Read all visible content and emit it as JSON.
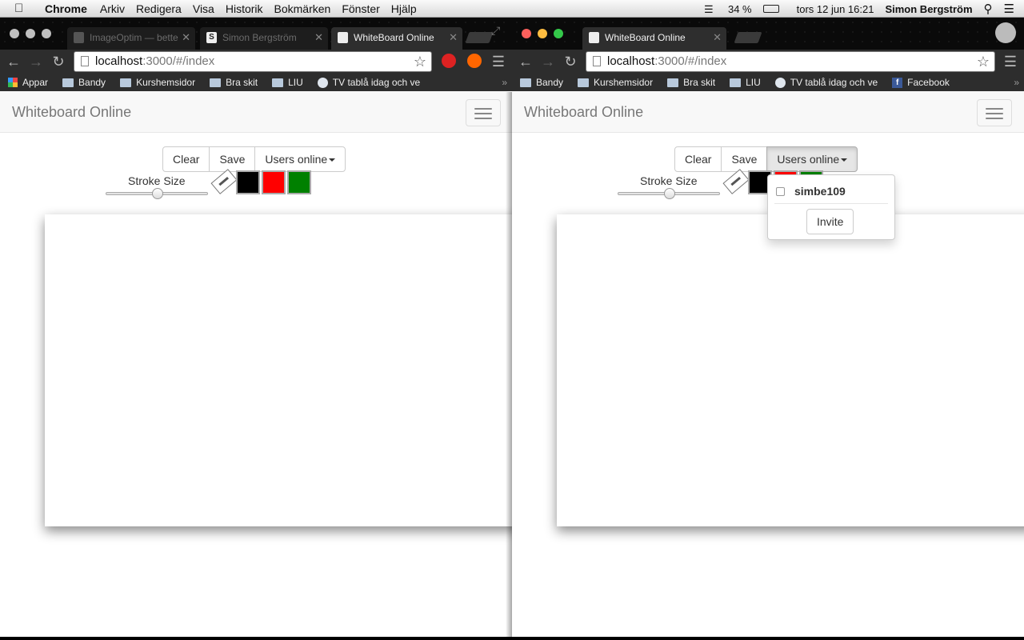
{
  "menubar": {
    "app_name": "Chrome",
    "items": [
      "Arkiv",
      "Redigera",
      "Visa",
      "Historik",
      "Bokmärken",
      "Fönster",
      "Hjälp"
    ],
    "battery": "34 %",
    "datetime": "tors 12 jun  16:21",
    "user": "Simon Bergström"
  },
  "left_window": {
    "tabs": [
      {
        "label": "ImageOptim — bette",
        "active": false
      },
      {
        "label": "Simon Bergström",
        "active": false
      },
      {
        "label": "WhiteBoard Online",
        "active": true
      }
    ],
    "url_host": "localhost",
    "url_path": ":3000/#/index",
    "bookmarks": [
      "Appar",
      "Bandy",
      "Kurshemsidor",
      "Bra skit",
      "LIU",
      "TV tablå idag och ve"
    ]
  },
  "right_window": {
    "tabs": [
      {
        "label": "WhiteBoard Online",
        "active": true
      }
    ],
    "url_host": "localhost",
    "url_path": ":3000/#/index",
    "bookmarks": [
      "Bandy",
      "Kurshemsidor",
      "Bra skit",
      "LIU",
      "TV tablå idag och ve",
      "Facebook"
    ]
  },
  "app": {
    "brand": "Whiteboard Online",
    "clear_label": "Clear",
    "save_label": "Save",
    "users_label": "Users online",
    "stroke_label": "Stroke Size",
    "stroke_value": 0.5,
    "colors": [
      "#000000",
      "#ff0000",
      "#008000"
    ],
    "online_users": [
      "simbe109"
    ],
    "invite_label": "Invite"
  },
  "bookmarks_more": "»"
}
